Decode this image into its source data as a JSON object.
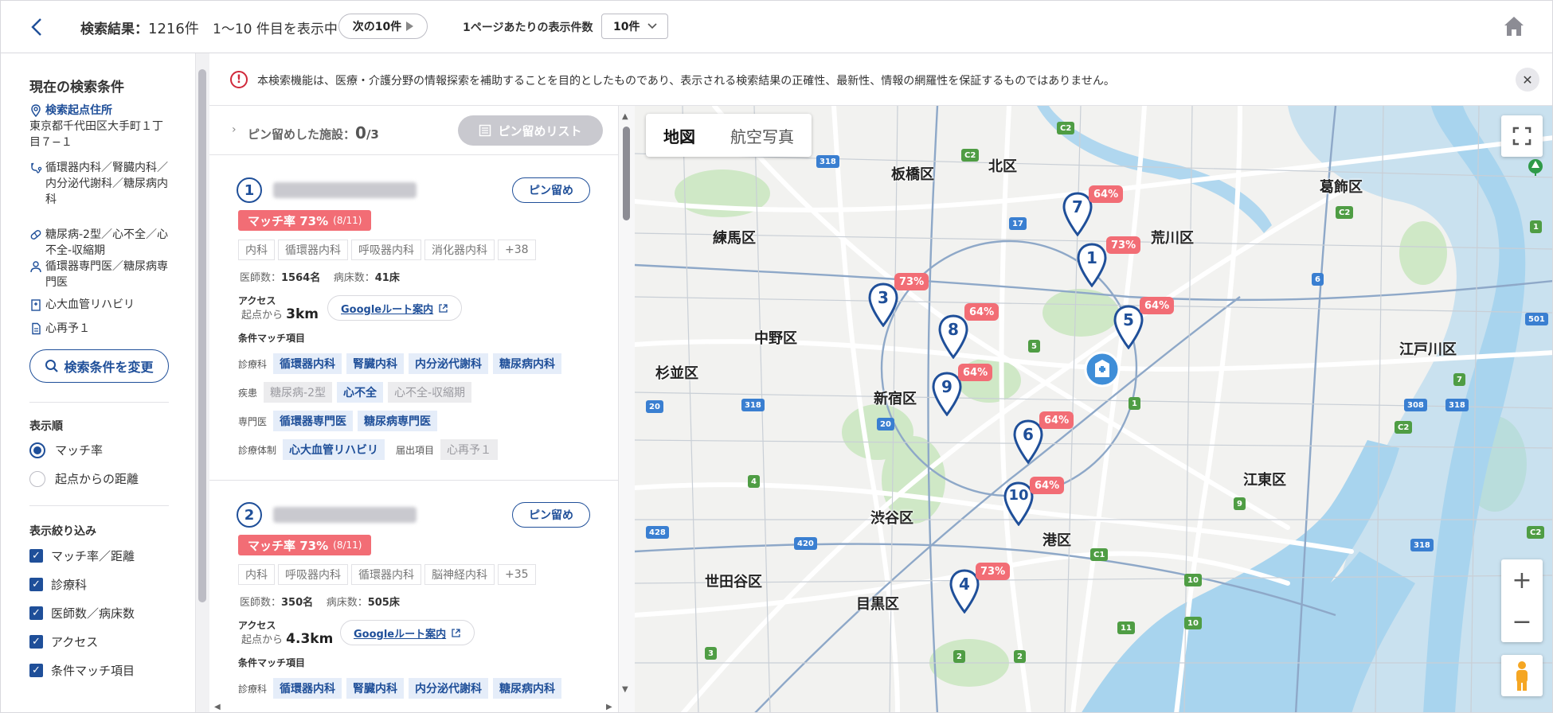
{
  "topbar": {
    "results_label": "検索結果：",
    "results_count": "1216",
    "results_unit": "件",
    "range_text": "1〜10 件目を表示中",
    "next_label": "次の10件",
    "per_page_label": "1ページあたりの表示件数",
    "per_page_value": "10件"
  },
  "sidebar": {
    "title": "現在の検索条件",
    "origin_label": "検索起点住所",
    "origin_address": "東京都千代田区大手町１丁目７−１",
    "departments": "循環器内科／腎臓内科／内分泌代謝科／糖尿病内科",
    "diseases": "糖尿病-2型／心不全／心不全-収縮期",
    "specialists": "循環器専門医／糖尿病専門医",
    "care_system": "心大血管リハビリ",
    "notification": "心再予１",
    "change_button": "検索条件を変更",
    "sort_title": "表示順",
    "sort_options": [
      "マッチ率",
      "起点からの距離"
    ],
    "filter_title": "表示絞り込み",
    "filters": [
      "マッチ率／距離",
      "診療科",
      "医師数／病床数",
      "アクセス",
      "条件マッチ項目"
    ]
  },
  "notice": {
    "text": "本検索機能は、医療・介護分野の情報探索を補助することを目的としたものであり、表示される検索結果の正確性、最新性、情報の網羅性を保証するものではありません。"
  },
  "pins": {
    "label": "ピン留めした施設：",
    "count": "0",
    "max": "/3",
    "list_button": "ピン留めリスト"
  },
  "cards": [
    {
      "no": "1",
      "pin_label": "ピン留め",
      "match_text": "マッチ率 73%",
      "match_ratio": "(8/11)",
      "tags": [
        "内科",
        "循環器内科",
        "呼吸器内科",
        "消化器内科",
        "+38"
      ],
      "doctors_label": "医師数：",
      "doctors": "1564名",
      "beds_label": "病床数：",
      "beds": "41床",
      "access_label": "アクセス",
      "dist_prefix": "起点から",
      "distance": "3km",
      "route_label": "Googleルート案内",
      "cond_label": "条件マッチ項目",
      "rows": {
        "dept_key": "診療科",
        "dept": [
          "循環器内科",
          "腎臓内科",
          "内分泌代謝科",
          "糖尿病内科"
        ],
        "dis_key": "疾患",
        "dis": [
          "糖尿病-2型",
          "心不全",
          "心不全-収縮期"
        ],
        "spec_key": "専門医",
        "spec": [
          "循環器専門医",
          "糖尿病専門医"
        ],
        "sys_key": "診療体制",
        "sys": [
          "心大血管リハビリ"
        ],
        "notif_key": "届出項目",
        "notif": [
          "心再予１"
        ]
      }
    },
    {
      "no": "2",
      "pin_label": "ピン留め",
      "match_text": "マッチ率 73%",
      "match_ratio": "(8/11)",
      "tags": [
        "内科",
        "呼吸器内科",
        "循環器内科",
        "脳神経内科",
        "+35"
      ],
      "doctors_label": "医師数：",
      "doctors": "350名",
      "beds_label": "病床数：",
      "beds": "505床",
      "access_label": "アクセス",
      "dist_prefix": "起点から",
      "distance": "4.3km",
      "route_label": "Googleルート案内",
      "cond_label": "条件マッチ項目",
      "rows": {
        "dept_key": "診療科",
        "dept": [
          "循環器内科",
          "腎臓内科",
          "内分泌代謝科",
          "糖尿病内科"
        ]
      }
    }
  ],
  "map": {
    "tab_map": "地図",
    "tab_aerial": "航空写真",
    "wards": [
      "板橋区",
      "北区",
      "葛飾区",
      "練馬区",
      "荒川区",
      "中野区",
      "江戸川区",
      "杉並区",
      "新宿区",
      "江東区",
      "渋谷区",
      "港区",
      "世田谷区",
      "目黒区"
    ],
    "markers": [
      {
        "no": "7",
        "badge": "64%"
      },
      {
        "no": "1",
        "badge": "73%"
      },
      {
        "no": "3",
        "badge": "73%"
      },
      {
        "no": "8",
        "badge": "64%"
      },
      {
        "no": "5",
        "badge": "64%"
      },
      {
        "no": "9",
        "badge": "64%"
      },
      {
        "no": "6",
        "badge": "64%"
      },
      {
        "no": "10",
        "badge": "64%"
      },
      {
        "no": "4",
        "badge": "73%"
      }
    ],
    "road_numbers": [
      "318",
      "C2",
      "C2",
      "17",
      "C2",
      "6",
      "501",
      "5",
      "1",
      "318",
      "20",
      "20",
      "7",
      "308",
      "318",
      "C2",
      "4",
      "9",
      "420",
      "428",
      "C1",
      "318",
      "10",
      "11",
      "3",
      "2",
      "2",
      "10",
      "C2",
      "1"
    ],
    "colors": {
      "water": "#a8d4ee",
      "park": "#cfe8c6",
      "road": "#ffffff",
      "marker": "#1f4f99",
      "badge": "#f26d75"
    }
  }
}
